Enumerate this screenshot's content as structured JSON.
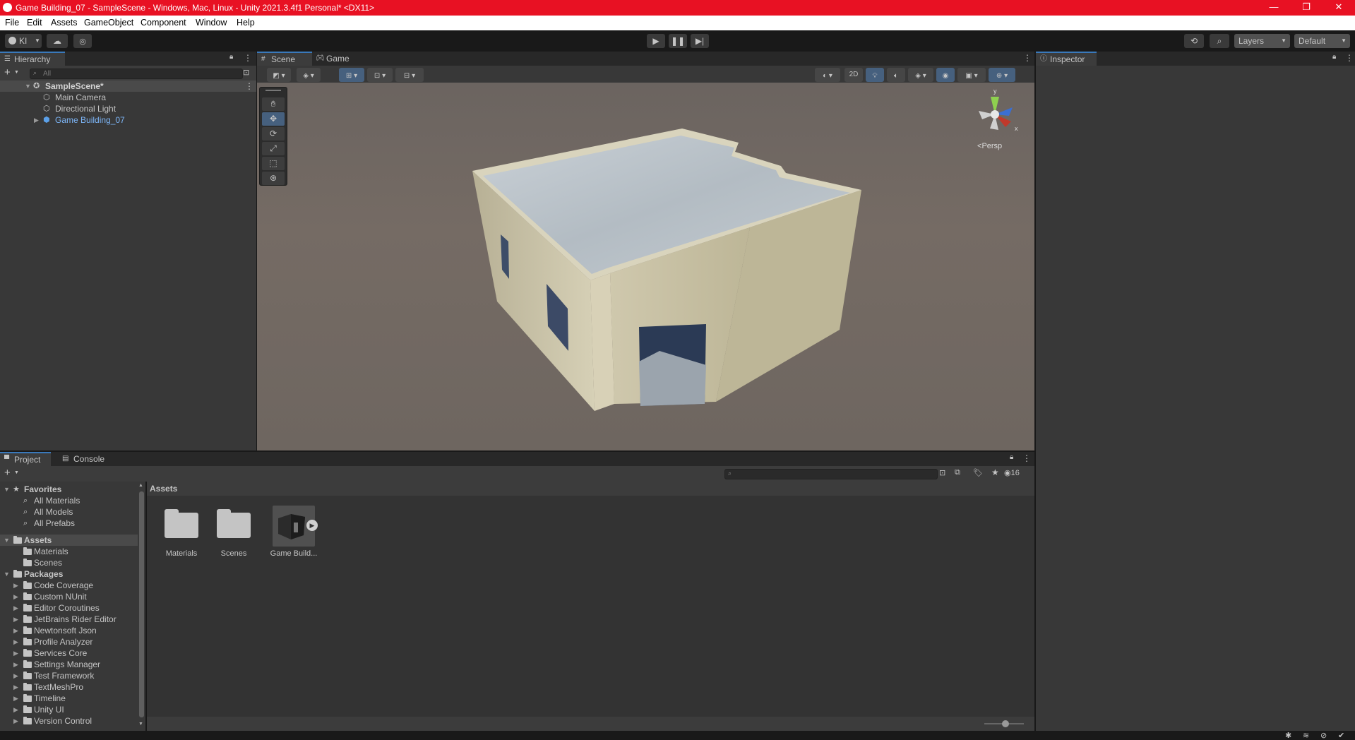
{
  "window": {
    "title": "Game Building_07 - SampleScene - Windows, Mac, Linux - Unity 2021.3.4f1 Personal* <DX11>",
    "controls": [
      "—",
      "❐",
      "✕"
    ]
  },
  "menu": [
    "File",
    "Edit",
    "Assets",
    "GameObject",
    "Component",
    "Window",
    "Help"
  ],
  "toolbar": {
    "account_label": "KI",
    "layers_label": "Layers",
    "layout_label": "Default"
  },
  "hierarchy": {
    "tab_label": "Hierarchy",
    "search_placeholder": "All",
    "scene": "SampleScene*",
    "items": [
      "Main Camera",
      "Directional Light",
      "Game Building_07"
    ]
  },
  "scene_view": {
    "tabs": [
      "Scene",
      "Game"
    ],
    "toggle_2d": "2D",
    "persp_label": "Persp",
    "gizmo_axes": {
      "y": "y",
      "x": "x"
    }
  },
  "inspector": {
    "tab_label": "Inspector"
  },
  "project": {
    "tabs": [
      "Project",
      "Console"
    ],
    "hidden_count": "16",
    "favorites_label": "Favorites",
    "favorites": [
      "All Materials",
      "All Models",
      "All Prefabs"
    ],
    "assets_label": "Assets",
    "asset_folders": [
      "Materials",
      "Scenes"
    ],
    "packages_label": "Packages",
    "packages": [
      "Code Coverage",
      "Custom NUnit",
      "Editor Coroutines",
      "JetBrains Rider Editor",
      "Newtonsoft Json",
      "Profile Analyzer",
      "Services Core",
      "Settings Manager",
      "Test Framework",
      "TextMeshPro",
      "Timeline",
      "Unity UI",
      "Version Control"
    ],
    "breadcrumb": "Assets",
    "grid_items": [
      "Materials",
      "Scenes",
      "Game Build..."
    ]
  },
  "colors": {
    "title_bar": "#e81123",
    "accent": "#3a79bb",
    "selected_text": "#7cb4f5"
  }
}
